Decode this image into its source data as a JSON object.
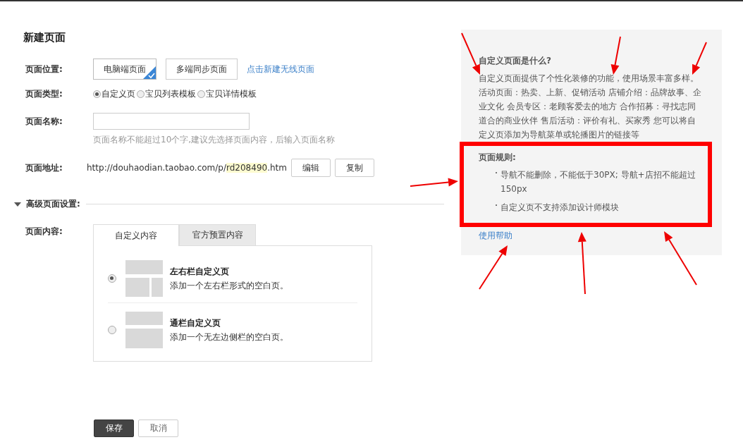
{
  "title": "新建页面",
  "location": {
    "label": "页面位置:",
    "options": [
      {
        "label": "电脑端页面",
        "selected": true
      },
      {
        "label": "多端同步页面",
        "selected": false
      }
    ],
    "link": "点击新建无线页面"
  },
  "type": {
    "label": "页面类型:",
    "options": [
      {
        "label": "自定义页",
        "selected": true
      },
      {
        "label": "宝贝列表模板",
        "selected": false
      },
      {
        "label": "宝贝详情模板",
        "selected": false
      }
    ]
  },
  "name": {
    "label": "页面名称:",
    "hint": "页面名称不能超过10个字,建议先选择页面内容，后输入页面名称"
  },
  "address": {
    "label": "页面地址:",
    "url_prefix": "http://douhaodian.taobao.com/p/",
    "url_slug": "rd208490",
    "url_suffix": ".htm",
    "buttons": [
      "编辑",
      "复制"
    ]
  },
  "advanced": {
    "label": "高级页面设置:",
    "expanded": true
  },
  "content": {
    "label": "页面内容:",
    "tabs": [
      {
        "label": "自定义内容",
        "selected": true
      },
      {
        "label": "官方预置内容",
        "selected": false
      }
    ],
    "options": [
      {
        "title": "左右栏自定义页",
        "description": "添加一个左右栏形式的空白页。",
        "kind": "split",
        "selected": true
      },
      {
        "title": "通栏自定义页",
        "description": "添加一个无左边侧栏的空白页。",
        "kind": "full",
        "selected": false
      }
    ]
  },
  "actions": [
    {
      "label": "保存",
      "kind": "primary"
    },
    {
      "label": "取消",
      "kind": "secondary"
    }
  ],
  "help": {
    "title": "自定义页面是什么?",
    "body": "自定义页面提供了个性化装修的功能，使用场景丰富多样。活动页面：热卖、上新、促销活动 店铺介绍：品牌故事、企业文化 会员专区：老顾客爱去的地方 合作招募：寻找志同道合的商业伙伴 售后活动：评价有礼、买家秀 您可以将自定义页添加为导航菜单或轮播图片的链接等",
    "rules_title": "页面规则:",
    "rules": [
      "导航不能删除，不能低于30PX; 导航+店招不能超过150px",
      "自定义页不支持添加设计师模块"
    ],
    "link": "使用帮助"
  }
}
